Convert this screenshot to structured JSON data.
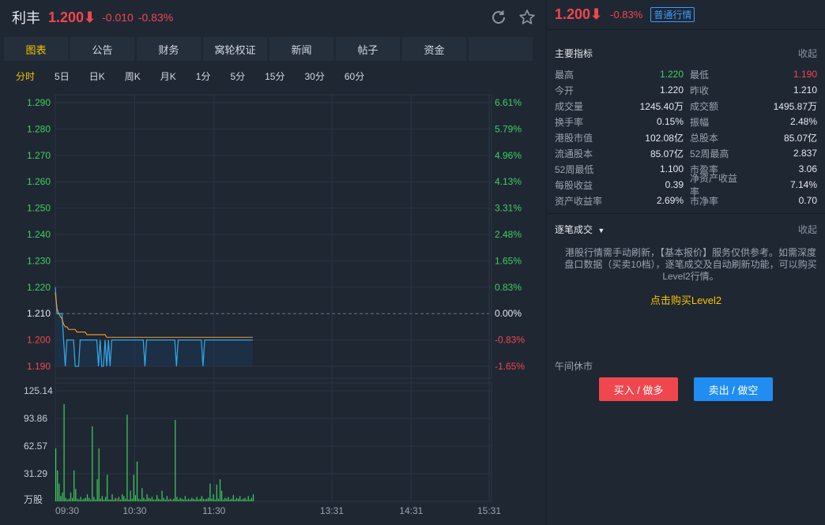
{
  "header": {
    "name": "利丰",
    "price": "1.200⬇",
    "change": "-0.010",
    "change_pct": "-0.83%",
    "refresh_icon": "refresh-icon",
    "star_icon": "star-icon"
  },
  "tabs": [
    {
      "label": "图表",
      "active": true
    },
    {
      "label": "公告"
    },
    {
      "label": "财务"
    },
    {
      "label": "窝轮权证"
    },
    {
      "label": "新闻"
    },
    {
      "label": "帖子"
    },
    {
      "label": "资金"
    },
    {
      "label": ""
    }
  ],
  "periods": [
    {
      "label": "分时",
      "active": true
    },
    {
      "label": "5日"
    },
    {
      "label": "日K"
    },
    {
      "label": "周K"
    },
    {
      "label": "月K"
    },
    {
      "label": "1分"
    },
    {
      "label": "5分"
    },
    {
      "label": "15分"
    },
    {
      "label": "30分"
    },
    {
      "label": "60分"
    }
  ],
  "chart_data": {
    "type": "line",
    "price_axis": {
      "ticks": [
        "1.290",
        "1.280",
        "1.270",
        "1.260",
        "1.250",
        "1.240",
        "1.230",
        "1.220",
        "1.210",
        "1.200",
        "1.190"
      ],
      "range": [
        1.19,
        1.29
      ]
    },
    "pct_axis": {
      "ticks": [
        "6.61%",
        "5.79%",
        "4.96%",
        "4.13%",
        "3.31%",
        "2.48%",
        "1.65%",
        "0.83%",
        "0.00%",
        "-0.83%",
        "-1.65%"
      ]
    },
    "prev_close": 1.21,
    "volume_axis": {
      "ticks": [
        "125.14",
        "93.86",
        "62.57",
        "31.29",
        "万股"
      ],
      "max": 125.14
    },
    "time_labels": [
      "09:30",
      "10:30",
      "11:30",
      "13:31",
      "14:31",
      "15:31"
    ],
    "price_series": [
      1.22,
      1.21,
      1.21,
      1.21,
      1.21,
      1.2,
      1.19,
      1.2,
      1.2,
      1.2,
      1.2,
      1.2,
      1.19,
      1.19,
      1.19,
      1.2,
      1.2,
      1.2,
      1.2,
      1.2,
      1.2,
      1.2,
      1.2,
      1.2,
      1.2,
      1.2,
      1.19,
      1.2,
      1.19,
      1.19,
      1.2,
      1.19,
      1.2,
      1.19,
      1.2,
      1.2,
      1.2,
      1.2,
      1.2,
      1.2,
      1.2,
      1.2,
      1.2,
      1.2,
      1.2,
      1.2,
      1.2,
      1.2,
      1.2,
      1.2,
      1.2,
      1.2,
      1.2,
      1.2,
      1.19,
      1.2,
      1.2,
      1.2,
      1.2,
      1.2,
      1.2,
      1.2,
      1.2,
      1.2,
      1.2,
      1.2,
      1.2,
      1.2,
      1.2,
      1.2,
      1.2,
      1.2,
      1.2,
      1.19,
      1.2,
      1.2,
      1.2,
      1.2,
      1.2,
      1.2,
      1.2,
      1.2,
      1.2,
      1.2,
      1.2,
      1.2,
      1.2,
      1.2,
      1.2,
      1.19,
      1.2,
      1.2,
      1.2,
      1.2,
      1.2,
      1.2,
      1.2,
      1.2,
      1.2,
      1.2,
      1.2,
      1.2,
      1.2,
      1.2,
      1.2,
      1.2,
      1.2,
      1.2,
      1.2,
      1.2,
      1.2,
      1.2,
      1.2,
      1.2,
      1.2,
      1.2,
      1.2,
      1.2,
      1.2,
      1.2
    ],
    "avg_series": [
      1.218,
      1.212,
      1.21,
      1.209,
      1.208,
      1.206,
      1.205,
      1.205,
      1.204,
      1.204,
      1.204,
      1.204,
      1.204,
      1.203,
      1.203,
      1.203,
      1.203,
      1.203,
      1.203,
      1.202,
      1.202,
      1.202,
      1.202,
      1.202,
      1.202,
      1.202,
      1.202,
      1.202,
      1.202,
      1.202,
      1.202,
      1.201,
      1.201,
      1.201,
      1.201,
      1.201,
      1.201,
      1.201,
      1.201,
      1.201,
      1.201,
      1.201,
      1.201,
      1.201,
      1.201,
      1.201,
      1.201,
      1.201,
      1.201,
      1.201,
      1.201,
      1.201,
      1.201,
      1.201,
      1.201,
      1.201,
      1.201,
      1.201,
      1.201,
      1.201,
      1.201,
      1.201,
      1.201,
      1.201,
      1.201,
      1.201,
      1.201,
      1.201,
      1.201,
      1.201,
      1.201,
      1.201,
      1.201,
      1.201,
      1.201,
      1.201,
      1.201,
      1.201,
      1.201,
      1.201,
      1.201,
      1.201,
      1.201,
      1.201,
      1.201,
      1.201,
      1.201,
      1.201,
      1.201,
      1.201,
      1.201,
      1.201,
      1.201,
      1.201,
      1.201,
      1.201,
      1.201,
      1.201,
      1.201,
      1.201,
      1.201,
      1.201,
      1.201,
      1.201,
      1.201,
      1.201,
      1.201,
      1.201,
      1.201,
      1.201,
      1.201,
      1.201,
      1.201,
      1.201,
      1.201,
      1.201,
      1.201,
      1.201,
      1.201,
      1.201
    ],
    "volume_series": [
      60,
      35,
      20,
      6,
      10,
      110,
      4,
      2,
      3,
      10,
      4,
      35,
      14,
      3,
      2,
      5,
      2,
      3,
      4,
      8,
      4,
      2,
      85,
      5,
      2,
      25,
      60,
      3,
      6,
      2,
      5,
      30,
      2,
      2,
      8,
      2,
      4,
      3,
      5,
      2,
      8,
      6,
      3,
      98,
      2,
      12,
      3,
      30,
      7,
      45,
      3,
      2,
      15,
      4,
      2,
      8,
      4,
      3,
      5,
      2,
      2,
      7,
      3,
      2,
      12,
      4,
      2,
      6,
      2,
      3,
      2,
      3,
      92,
      5,
      2,
      4,
      3,
      2,
      6,
      2,
      3,
      2,
      4,
      3,
      2,
      5,
      2,
      3,
      6,
      3,
      2,
      3,
      4,
      20,
      3,
      8,
      2,
      19,
      3,
      25,
      12,
      2,
      4,
      3,
      5,
      2,
      3,
      7,
      2,
      4,
      3,
      6,
      2,
      3,
      4,
      2,
      6,
      2,
      4,
      8
    ],
    "volume_colors_red_idx": [
      37,
      70
    ]
  },
  "panel": {
    "price": "1.200⬇",
    "change_pct": "-0.83%",
    "badge": "普通行情",
    "main_title": "主要指标",
    "collapse": "收起",
    "stats": [
      {
        "l1": "最高",
        "v1": "1.220",
        "c1": "#3fd05f",
        "l2": "最低",
        "v2": "1.190",
        "c2": "#f0474f"
      },
      {
        "l1": "今开",
        "v1": "1.220",
        "c1": "",
        "l2": "昨收",
        "v2": "1.210",
        "c2": ""
      },
      {
        "l1": "成交量",
        "v1": "1245.40万",
        "c1": "",
        "l2": "成交额",
        "v2": "1495.87万",
        "c2": ""
      },
      {
        "l1": "换手率",
        "v1": "0.15%",
        "c1": "",
        "l2": "振幅",
        "v2": "2.48%",
        "c2": ""
      },
      {
        "l1": "港股市值",
        "v1": "102.08亿",
        "c1": "",
        "l2": "总股本",
        "v2": "85.07亿",
        "c2": ""
      },
      {
        "l1": "流通股本",
        "v1": "85.07亿",
        "c1": "",
        "l2": "52周最高",
        "v2": "2.837",
        "c2": ""
      },
      {
        "l1": "52周最低",
        "v1": "1.100",
        "c1": "",
        "l2": "市盈率",
        "v2": "3.06",
        "c2": ""
      },
      {
        "l1": "每股收益",
        "v1": "0.39",
        "c1": "",
        "l2": "净资产收益率",
        "v2": "7.14%",
        "c2": ""
      },
      {
        "l1": "资产收益率",
        "v1": "2.69%",
        "c1": "",
        "l2": "市净率",
        "v2": "0.70",
        "c2": ""
      }
    ],
    "tick_title": "逐笔成交",
    "tick_collapse": "收起",
    "notice": "港股行情需手动刷新，【基本报价】服务仅供参考。如需深度盘口数据（买卖10档），逐笔成交及自动刷新功能，可以购买Level2行情。",
    "buy_l2": "点击购买Level2",
    "midday": "午间休市",
    "buy_btn": "买入 / 做多",
    "sell_btn": "卖出 / 做空"
  },
  "colors": {
    "up": "#3fd05f",
    "down": "#f0474f",
    "price_line": "#2fa6e6",
    "avg_line": "#f0a030",
    "accent": "#f5c400"
  }
}
